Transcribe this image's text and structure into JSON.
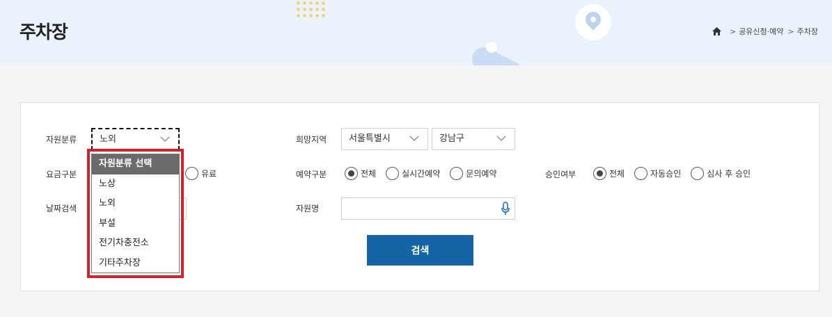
{
  "header": {
    "title": "주차장",
    "breadcrumb": [
      "공유신청·예약",
      "주차장"
    ]
  },
  "form": {
    "resource_type": {
      "label": "자원분류",
      "value": "노외",
      "options": [
        "자원분류 선택",
        "노상",
        "노외",
        "부설",
        "전기차충전소",
        "기타주차장"
      ],
      "highlighted_option": "자원분류 선택"
    },
    "region": {
      "label": "희망지역",
      "city": "서울특별시",
      "district": "강남구"
    },
    "fee_type": {
      "label": "요금구분",
      "visible_option": "유료"
    },
    "reservation_type": {
      "label": "예약구분",
      "options": [
        "전체",
        "실시간예약",
        "문의예약"
      ],
      "selected": "전체"
    },
    "approval": {
      "label": "승인여부",
      "options": [
        "전체",
        "자동승인",
        "심사 후 승인"
      ],
      "selected": "전체"
    },
    "date_search": {
      "label": "날짜검색"
    },
    "resource_name": {
      "label": "자원명",
      "value": ""
    },
    "search_label": "검색"
  },
  "colors": {
    "header_bg": "#eaf2fb",
    "primary": "#1565a6",
    "highlight": "#d6202a"
  }
}
